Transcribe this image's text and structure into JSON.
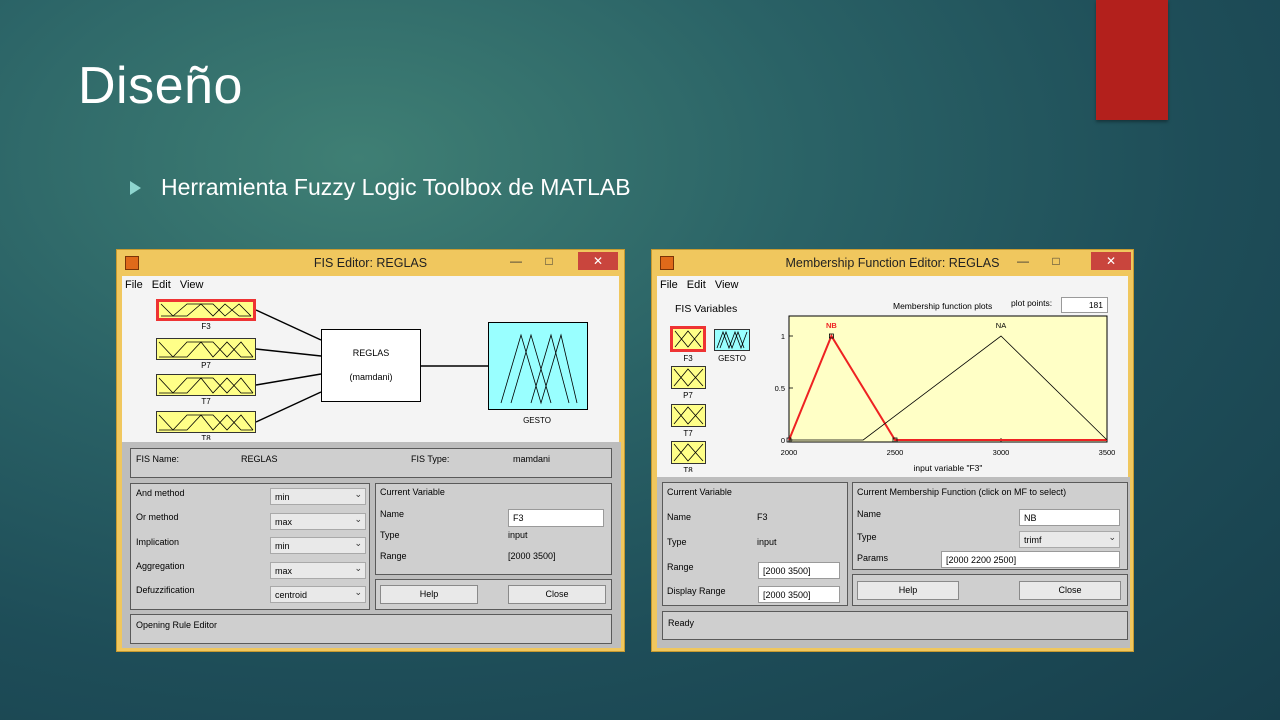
{
  "slide": {
    "title": "Diseño",
    "bullet": "Herramienta Fuzzy Logic Toolbox de MATLAB"
  },
  "colors": {
    "accent_tab": "#b3201c",
    "window_frame": "#f0c75e",
    "mf_fill": "#ffff88",
    "output_fill": "#99ffff",
    "selected": "#ee3333"
  },
  "fis_editor": {
    "title": "FIS Editor: REGLAS",
    "menu": [
      "File",
      "Edit",
      "View"
    ],
    "inputs": [
      "F3",
      "P7",
      "T7",
      "T8"
    ],
    "system_name": "REGLAS",
    "system_type": "(mamdani)",
    "output": "GESTO",
    "fis_name_label": "FIS Name:",
    "fis_name": "REGLAS",
    "fis_type_label": "FIS Type:",
    "fis_type": "mamdani",
    "methods": [
      {
        "label": "And method",
        "value": "min"
      },
      {
        "label": "Or method",
        "value": "max"
      },
      {
        "label": "Implication",
        "value": "min"
      },
      {
        "label": "Aggregation",
        "value": "max"
      },
      {
        "label": "Defuzzification",
        "value": "centroid"
      }
    ],
    "current_variable": {
      "header": "Current Variable",
      "name_label": "Name",
      "name": "F3",
      "type_label": "Type",
      "type": "input",
      "range_label": "Range",
      "range": "[2000 3500]"
    },
    "help": "Help",
    "close": "Close",
    "status": "Opening Rule Editor"
  },
  "mf_editor": {
    "title": "Membership Function Editor: REGLAS",
    "menu": [
      "File",
      "Edit",
      "View"
    ],
    "fis_variables_label": "FIS Variables",
    "variables": [
      "F3",
      "GESTO",
      "P7",
      "T7",
      "T8"
    ],
    "plot_title": "Membership function plots",
    "plot_points_label": "plot points:",
    "plot_points": "181",
    "current_variable": {
      "header": "Current Variable",
      "name_label": "Name",
      "name": "F3",
      "type_label": "Type",
      "type": "input",
      "range_label": "Range",
      "range": "[2000 3500]",
      "display_range_label": "Display Range",
      "display_range": "[2000 3500]"
    },
    "current_mf": {
      "header": "Current Membership Function (click on MF to select)",
      "name_label": "Name",
      "name": "NB",
      "type_label": "Type",
      "type": "trimf",
      "params_label": "Params",
      "params": "[2000 2200 2500]"
    },
    "help": "Help",
    "close": "Close",
    "status": "Ready"
  },
  "chart_data": {
    "type": "line",
    "xlabel": "input variable \"F3\"",
    "ylabel": "",
    "xlim": [
      2000,
      3500
    ],
    "ylim": [
      0,
      1
    ],
    "xticks": [
      "2000",
      "2500",
      "3000",
      "3500"
    ],
    "yticks": [
      "0",
      "0.5",
      "1"
    ],
    "series": [
      {
        "name": "NB",
        "x": [
          2000,
          2200,
          2500,
          3500
        ],
        "y": [
          0,
          1,
          0,
          0
        ],
        "selected": true
      },
      {
        "name": "NA",
        "x": [
          2000,
          2350,
          3000,
          3500
        ],
        "y": [
          0,
          0,
          1,
          0
        ],
        "selected": false
      }
    ]
  }
}
